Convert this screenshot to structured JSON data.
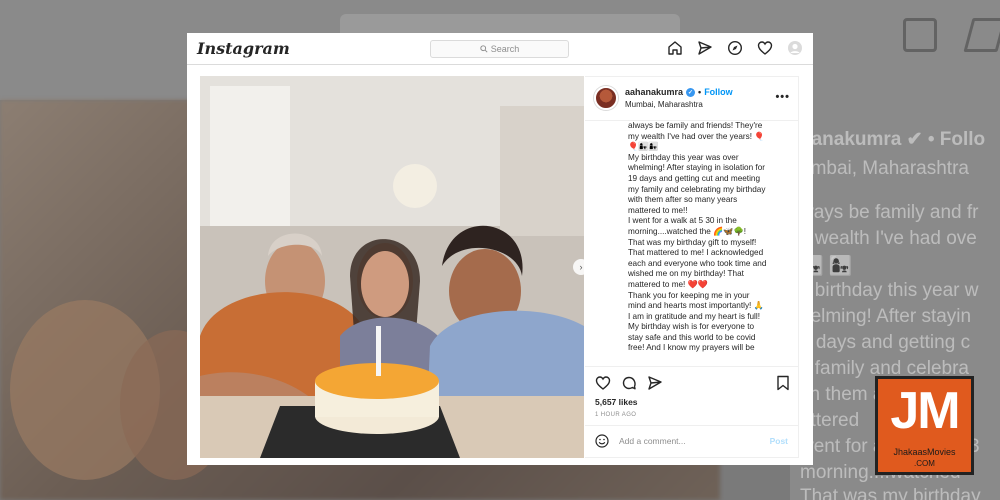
{
  "app": {
    "logo": "Instagram"
  },
  "nav": {
    "search_placeholder": "Search",
    "search_icon": "search-icon"
  },
  "post": {
    "username": "aahanakumra",
    "follow_label": "Follow",
    "separator": "•",
    "location": "Mumbai, Maharashtra",
    "more_label": "•••",
    "caption_lines": [
      "always be family and friends! They're",
      "my wealth I've had over the years! 🎈",
      "🎈👩‍👧👩‍👧",
      "My birthday this year was over",
      "whelming! After staying in isolation for",
      "19 days and getting cut and meeting",
      "my family and celebrating my birthday",
      "with them after so many years",
      "mattered to me!!",
      "I went for a walk at 5 30 in the",
      "morning....watched the 🌈🦋🌳!",
      "That was my birthday gift to myself!",
      "That mattered to me! I acknowledged",
      "each and everyone who took time and",
      "wished me on my birthday! That",
      "mattered to me! ❤️❤️",
      "Thank you for keeping me in your",
      "mind and hearts most importantly! 🙏",
      "I am in gratitude and my heart is full!",
      "My birthday wish is for everyone to",
      "stay safe and this world to be covid",
      "free! And I know my prayers will be"
    ],
    "likes": "5,657 likes",
    "time": "1 HOUR AGO",
    "comment_placeholder": "Add a comment...",
    "post_label": "Post",
    "carousel_arrow": "›"
  },
  "watermark": {
    "letters": "JM",
    "name": "JhakaasMovies",
    "suffix": ".COM"
  },
  "background": {
    "blur_lines": [
      "hanakumra ✔ • Follo",
      "umbai, Maharashtra",
      "ways be family and fr",
      "y wealth I've had ove",
      "👩‍👧 👩‍👧",
      "y birthday this year w",
      "helming! After stayin",
      "9 days and getting c",
      "y family and celebra",
      "ith them after so ma",
      "attered",
      "went for a walk at 5 3",
      "morning....watched",
      "That was my birthday"
    ]
  },
  "colors": {
    "link": "#0095f6",
    "verified": "#3897f0",
    "watermark": "#e05a1e"
  }
}
